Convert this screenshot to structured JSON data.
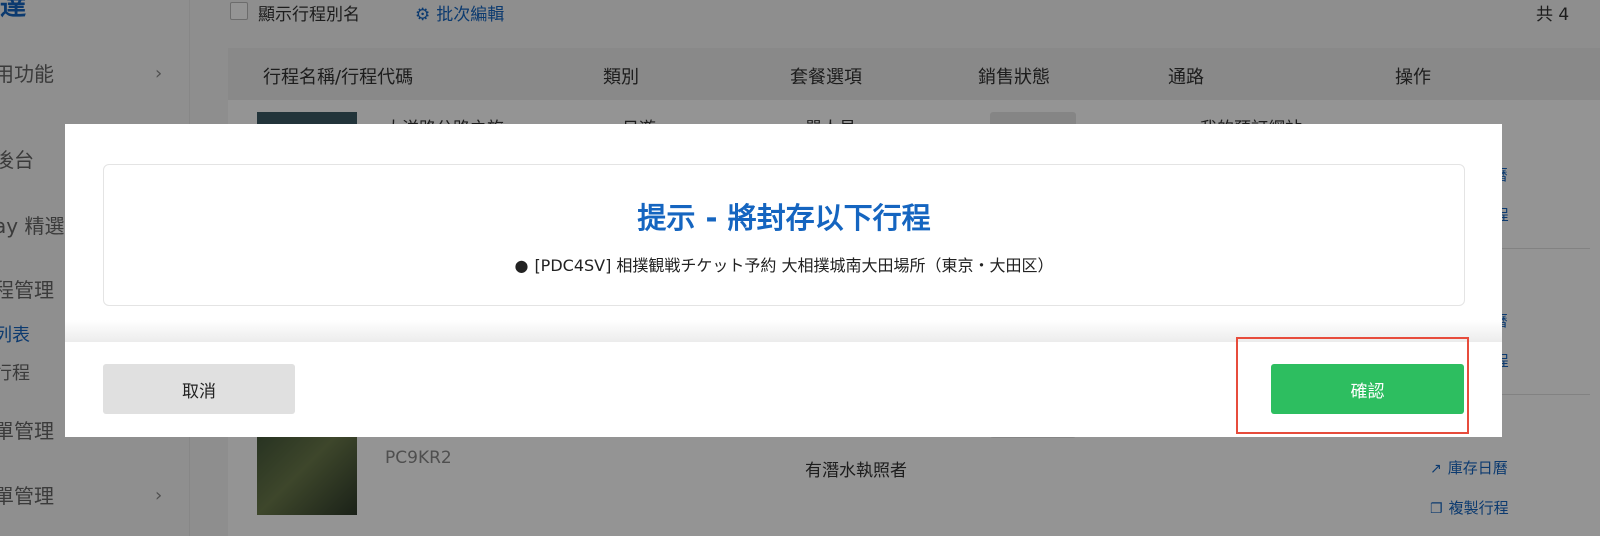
{
  "sidebar": {
    "logo_fragment": "達",
    "items": [
      {
        "label": "用功能",
        "chevron": "›"
      },
      {
        "label": "後台",
        "chevron": ""
      },
      {
        "label": "ay 精選",
        "chevron": ""
      },
      {
        "label": "程管理",
        "chevron": ""
      },
      {
        "label": "列表",
        "chevron": ""
      },
      {
        "label": "行程",
        "chevron": ""
      },
      {
        "label": "單管理",
        "chevron": "›"
      },
      {
        "label": "單管理",
        "chevron": "›"
      }
    ]
  },
  "toolbar": {
    "show_alias_label": "顯示行程別名",
    "batch_edit_label": "批次編輯",
    "total_label": "共 4"
  },
  "table": {
    "headers": [
      "行程名稱/行程代碼",
      "類別",
      "套餐選項",
      "銷售狀態",
      "通路",
      "操作"
    ],
    "rows": [
      {
        "name": "大洋路公路之旅",
        "category": "日遊",
        "option": "單人員",
        "channel": "我的預訂網站"
      },
      {
        "code": "PC9KR2",
        "option": "有潛水執照者"
      }
    ],
    "ops": {
      "calendar": "日曆",
      "inventory_calendar": "庫存日曆",
      "copy_itinerary": "複製行程",
      "itinerary": "行程"
    }
  },
  "modal": {
    "title": "提示 - 將封存以下行程",
    "item": "[PDC4SV] 相撲観戦チケット予約 大相撲城南大田場所（東京・大田区）",
    "bullet": "●",
    "cancel_label": "取消",
    "confirm_label": "確認"
  },
  "colors": {
    "accent": "#1565c0",
    "confirm": "#2dbe60",
    "highlight": "#e74c3c"
  }
}
